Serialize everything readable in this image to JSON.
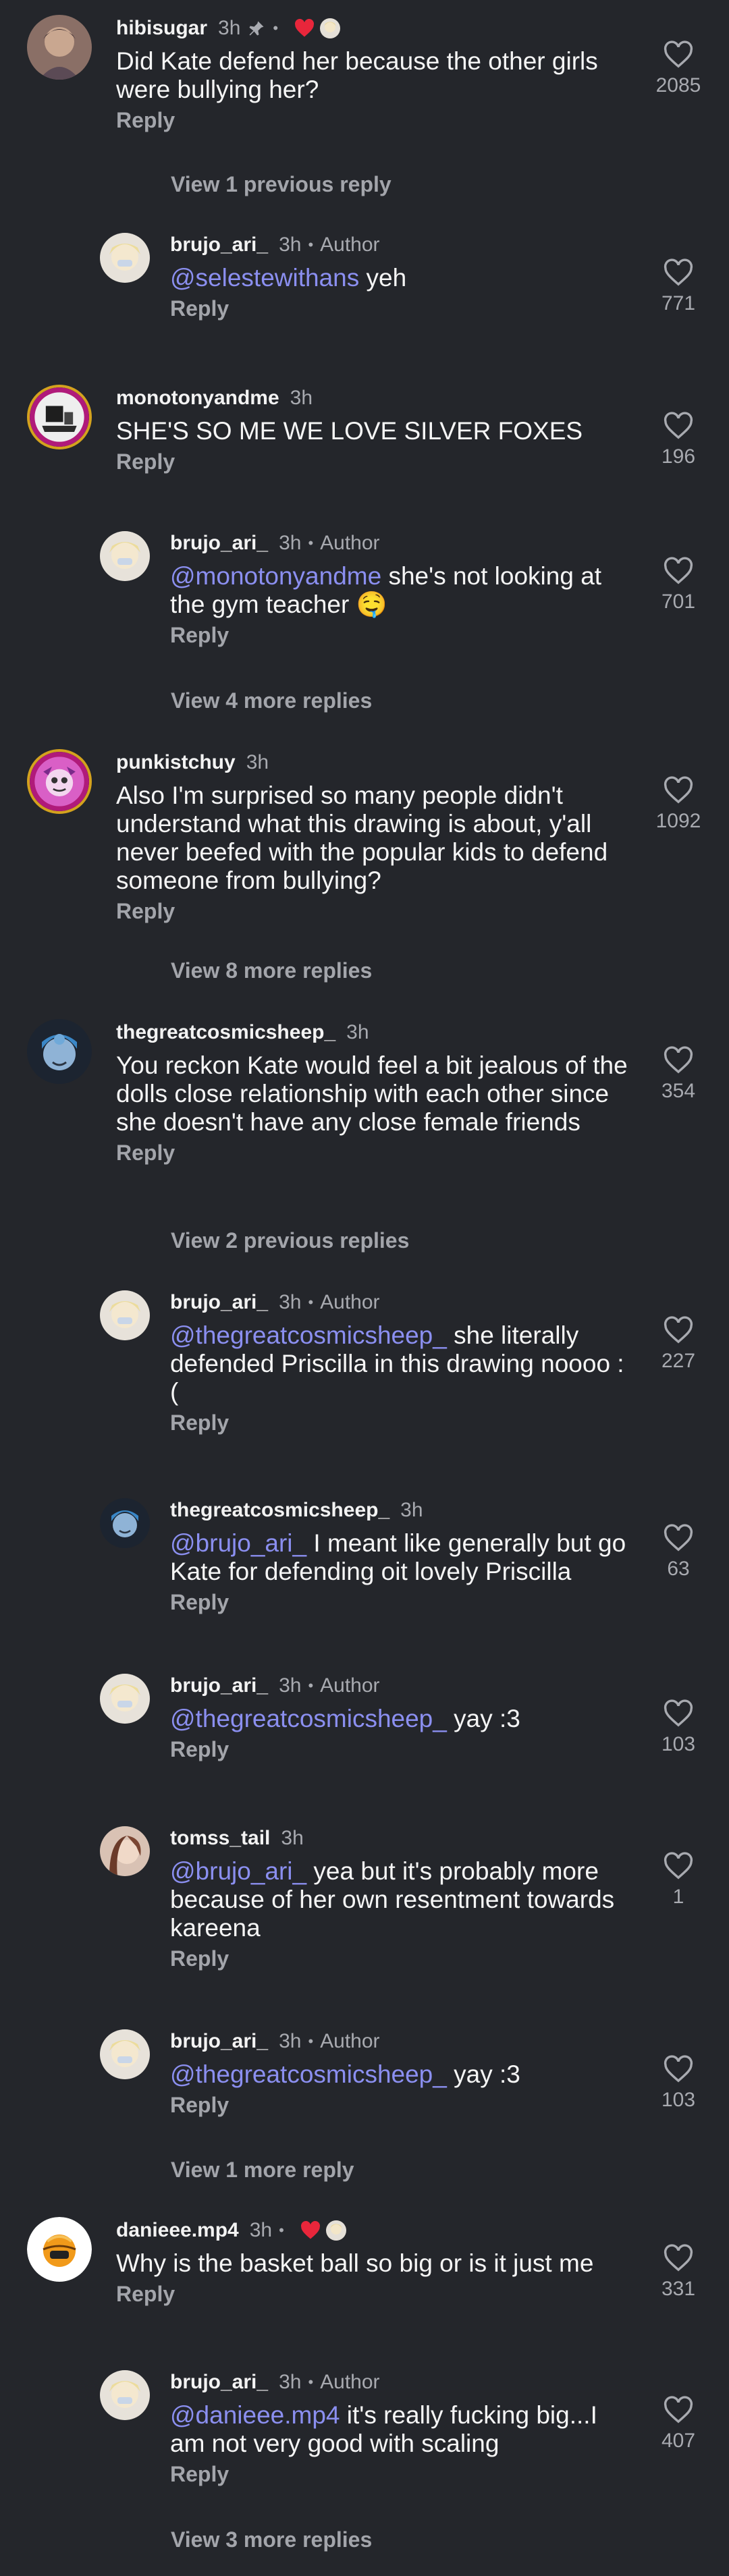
{
  "comments": [
    {
      "user": "hibisugar",
      "time": "3h",
      "author": "",
      "text": "Did Kate defend her because the other girls were bullying her?",
      "mention": "",
      "likes": "2085",
      "reply": "Reply",
      "pinned": true,
      "creator_liked": true
    },
    {
      "user": "brujo_ari_",
      "time": "3h",
      "author": "Author",
      "text": "yeh",
      "mention": "@selestewithans",
      "likes": "771",
      "reply": "Reply"
    },
    {
      "user": "monotonyandme",
      "time": "3h",
      "author": "",
      "text": "SHE'S SO ME WE LOVE SILVER FOXES",
      "mention": "",
      "likes": "196",
      "reply": "Reply"
    },
    {
      "user": "brujo_ari_",
      "time": "3h",
      "author": "Author",
      "text": "she's not looking at the gym teacher 🤤",
      "mention": "@monotonyandme",
      "likes": "701",
      "reply": "Reply"
    },
    {
      "user": "punkistchuy",
      "time": "3h",
      "author": "",
      "text": "Also I'm surprised so many people didn't understand what this drawing is about, y'all never beefed with the popular kids to defend someone from bullying?",
      "mention": "",
      "likes": "1092",
      "reply": "Reply"
    },
    {
      "user": "thegreatcosmicsheep_",
      "time": "3h",
      "author": "",
      "text": "You reckon Kate would feel a bit jealous of the dolls close relationship with each other since she doesn't have any close female friends",
      "mention": "",
      "likes": "354",
      "reply": "Reply"
    },
    {
      "user": "brujo_ari_",
      "time": "3h",
      "author": "Author",
      "text": "she literally defended Priscilla in this drawing noooo :(",
      "mention": "@thegreatcosmicsheep_",
      "likes": "227",
      "reply": "Reply"
    },
    {
      "user": "thegreatcosmicsheep_",
      "time": "3h",
      "author": "",
      "text": "I meant like generally but go Kate for defending oit lovely Priscilla",
      "mention": "@brujo_ari_",
      "likes": "63",
      "reply": "Reply"
    },
    {
      "user": "brujo_ari_",
      "time": "3h",
      "author": "Author",
      "text": "yay :3",
      "mention": "@thegreatcosmicsheep_",
      "likes": "103",
      "reply": "Reply"
    },
    {
      "user": "tomss_tail",
      "time": "3h",
      "author": "",
      "text": "yea but it's probably more because of her own resentment towards kareena",
      "mention": "@brujo_ari_",
      "likes": "1",
      "reply": "Reply"
    },
    {
      "user": "brujo_ari_",
      "time": "3h",
      "author": "Author",
      "text": "yay :3",
      "mention": "@thegreatcosmicsheep_",
      "likes": "103",
      "reply": "Reply"
    },
    {
      "user": "danieee.mp4",
      "time": "3h",
      "author": "",
      "text": "Why is the basket ball so big or is it just me",
      "mention": "",
      "likes": "331",
      "reply": "Reply",
      "creator_liked": true
    },
    {
      "user": "brujo_ari_",
      "time": "3h",
      "author": "Author",
      "text": "it's really fucking big...I am not very good with scaling",
      "mention": "@danieee.mp4",
      "likes": "407",
      "reply": "Reply"
    }
  ],
  "view_links": [
    "View 1 previous reply",
    "View 4 more replies",
    "View 8 more replies",
    "View 2 previous replies",
    "View 1 more reply",
    "View 3 more replies"
  ],
  "colors": {
    "background": "#24262b",
    "mention": "#8b8ff0",
    "muted": "#a8aab0",
    "heart_red": "#e8263b"
  }
}
